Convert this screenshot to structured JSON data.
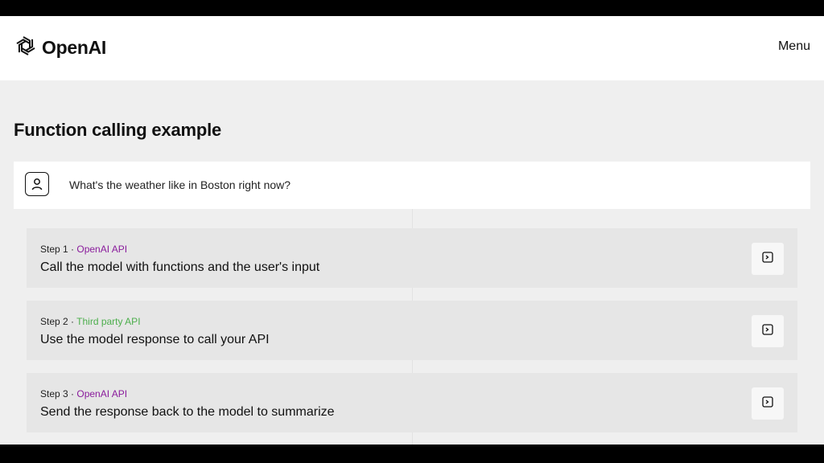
{
  "header": {
    "logo_text": "OpenAI",
    "menu_label": "Menu"
  },
  "main": {
    "title": "Function calling example",
    "query": {
      "text": "What's the weather like in Boston right now?",
      "icon": "user-icon"
    },
    "steps": [
      {
        "step_label": "Step 1",
        "separator": " · ",
        "api_label": "OpenAI API",
        "api_color": "#8a1c9c",
        "title": "Call the model with functions and the user's input",
        "button_icon": "terminal-icon"
      },
      {
        "step_label": "Step 2",
        "separator": " · ",
        "api_label": "Third party API",
        "api_color": "#4cae4c",
        "title": "Use the model response to call your API",
        "button_icon": "terminal-icon"
      },
      {
        "step_label": "Step 3",
        "separator": " · ",
        "api_label": "OpenAI API",
        "api_color": "#8a1c9c",
        "title": "Send the response back to the model to summarize",
        "button_icon": "terminal-icon"
      }
    ]
  }
}
